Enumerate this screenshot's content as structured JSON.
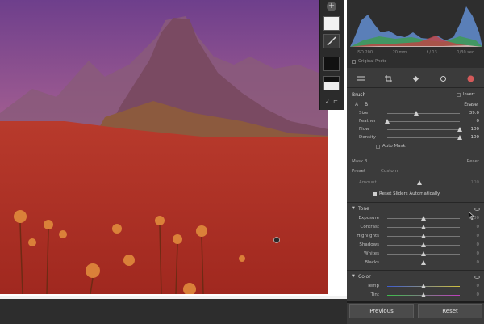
{
  "histogram": {
    "iso": "ISO 200",
    "focal": "20 mm",
    "aperture": "f / 13",
    "shutter": "1/30 sec",
    "original_photo_label": "Original Photo"
  },
  "brush": {
    "title": "Brush",
    "invert_label": "Invert",
    "a_label": "A",
    "b_label": "B",
    "erase_label": "Erase",
    "size_label": "Size",
    "size_value": "39.0",
    "size_level": 0.4,
    "feather_label": "Feather",
    "feather_value": "0",
    "feather_level": 0.0,
    "flow_label": "Flow",
    "flow_value": "100",
    "flow_level": 1.0,
    "density_label": "Density",
    "density_value": "100",
    "density_level": 1.0,
    "automask_label": "Auto Mask"
  },
  "mask": {
    "name": "Mask 3",
    "reset_label": "Reset",
    "preset_label": "Preset",
    "preset_value": "Custom",
    "amount_label": "Amount",
    "amount_value": "100",
    "reset_sliders_label": "Reset Sliders Automatically"
  },
  "tone": {
    "title": "Tone",
    "rows": [
      {
        "label": "Exposure",
        "value": "0.00",
        "level": 0.5
      },
      {
        "label": "Contrast",
        "value": "0",
        "level": 0.5
      },
      {
        "label": "Highlights",
        "value": "0",
        "level": 0.5
      },
      {
        "label": "Shadows",
        "value": "0",
        "level": 0.5
      },
      {
        "label": "Whites",
        "value": "0",
        "level": 0.5
      },
      {
        "label": "Blacks",
        "value": "0",
        "level": 0.5
      }
    ]
  },
  "color": {
    "title": "Color",
    "rows": [
      {
        "label": "Temp",
        "value": "0",
        "level": 0.5
      },
      {
        "label": "Tint",
        "value": "0",
        "level": 0.5
      }
    ]
  },
  "buttons": {
    "previous": "Previous",
    "reset": "Reset"
  },
  "colors": {
    "panel": "#3b3b3b",
    "mask_overlay": "#c8323c",
    "accent": "#d0d0d0"
  }
}
